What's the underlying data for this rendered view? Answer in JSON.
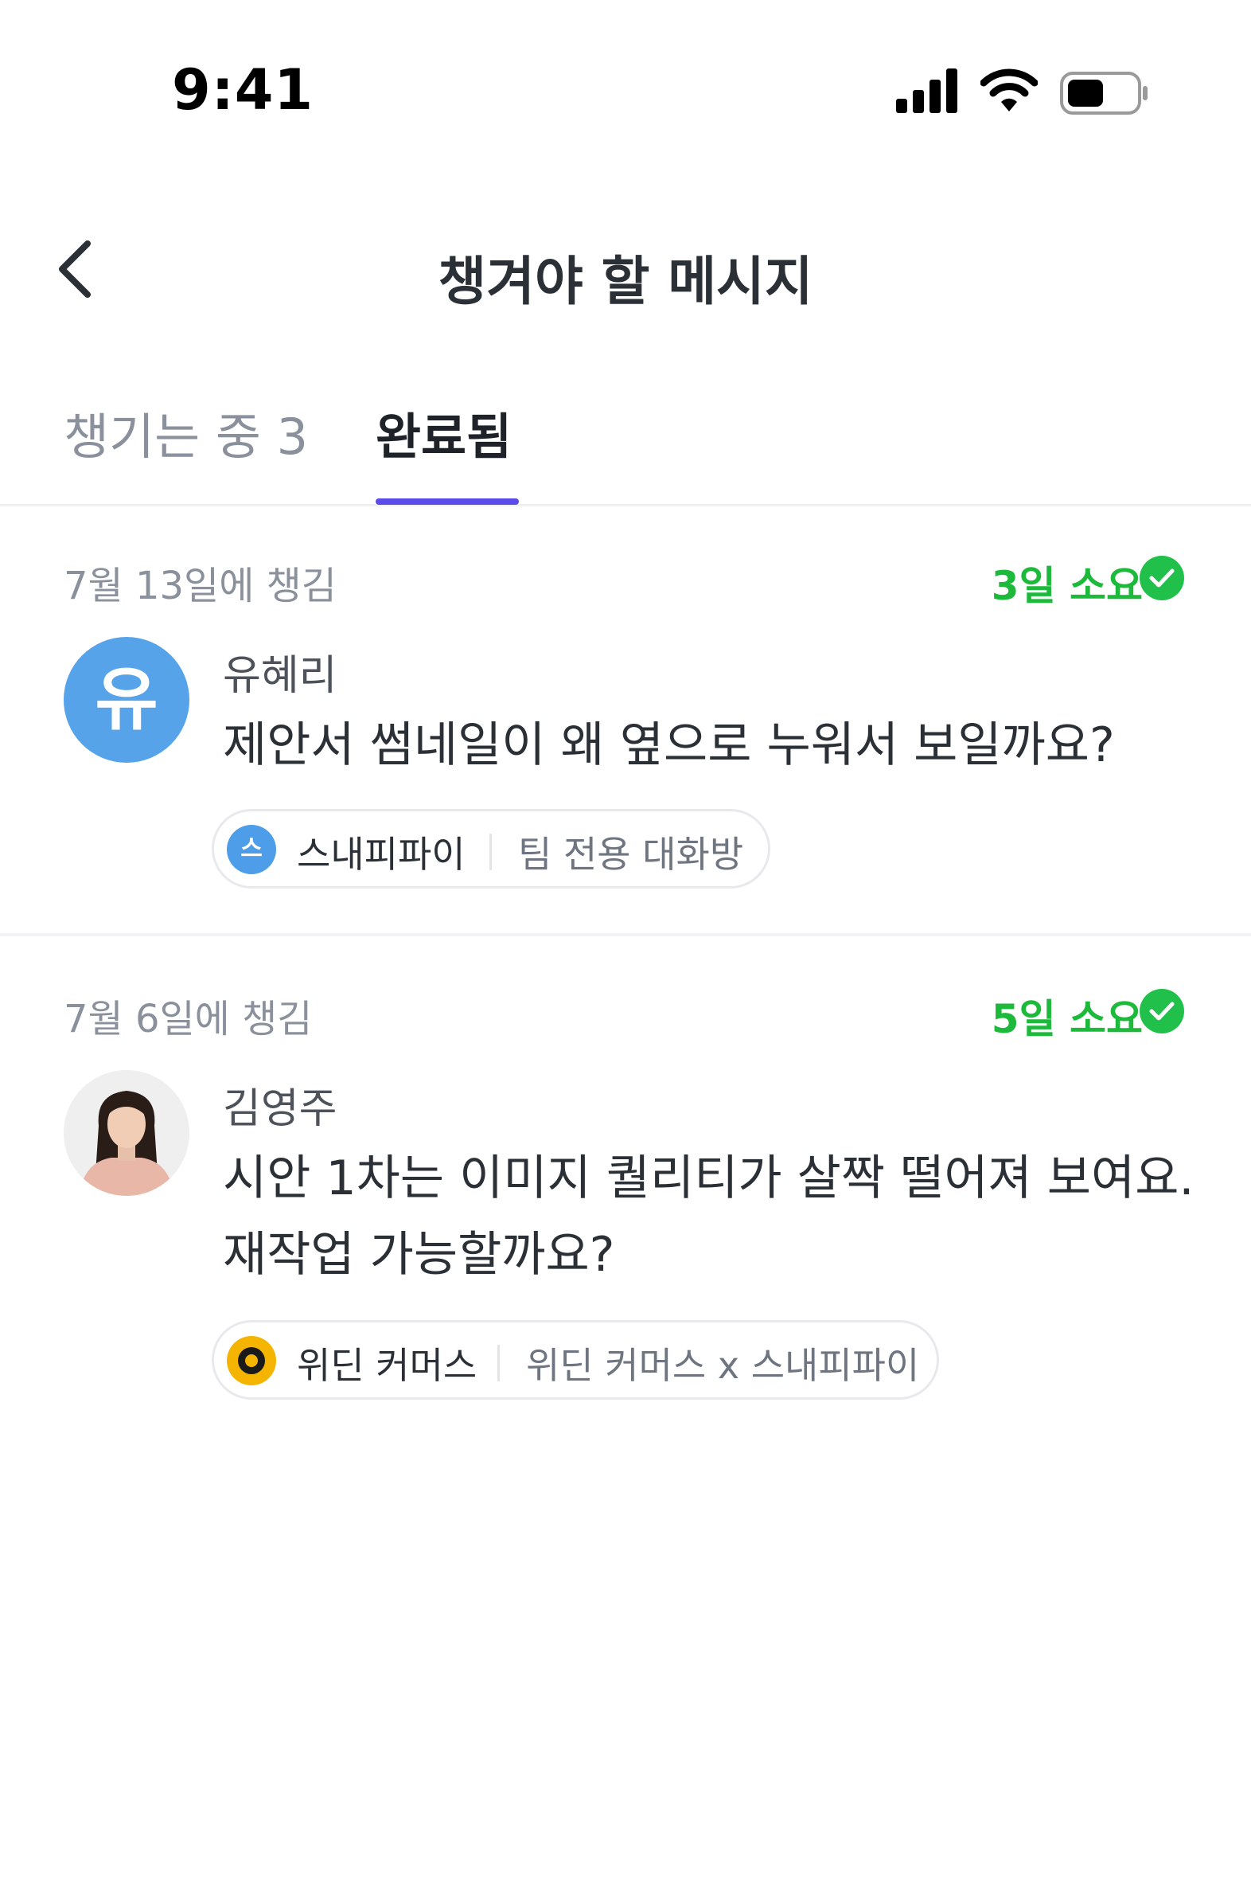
{
  "status_bar": {
    "time": "9:41",
    "icons": [
      "cellular-signal-icon",
      "wifi-icon",
      "battery-icon"
    ]
  },
  "header": {
    "title": "챙겨야 할 메시지",
    "back_icon": "chevron-left-icon"
  },
  "tabs": [
    {
      "label": "챙기는 중 3",
      "active": false
    },
    {
      "label": "완료됨",
      "active": true
    }
  ],
  "colors": {
    "accent": "#5b4be8",
    "success": "#21c04a",
    "duration_text": "#1db93b",
    "avatar_blue": "#56a3ea",
    "muted_text": "#8b919c"
  },
  "items": [
    {
      "date": "7월 13일에 챙김",
      "duration": "3일 소요",
      "sender": "유혜리",
      "avatar_text": "유",
      "message": "제안서 썸네일이 왜 옆으로 누워서 보일까요?",
      "org_logo_text": "스",
      "org": "스내피파이",
      "room": "팀 전용 대화방"
    },
    {
      "date": "7월 6일에 챙김",
      "duration": "5일 소요",
      "sender": "김영주",
      "message_lines": [
        "시안 1차는 이미지 퀄리티가 살짝 떨어져 보여요.",
        "재작업 가능할까요?"
      ],
      "org": "위딘 커머스",
      "room": "위딘 커머스 x 스내피파이"
    }
  ]
}
